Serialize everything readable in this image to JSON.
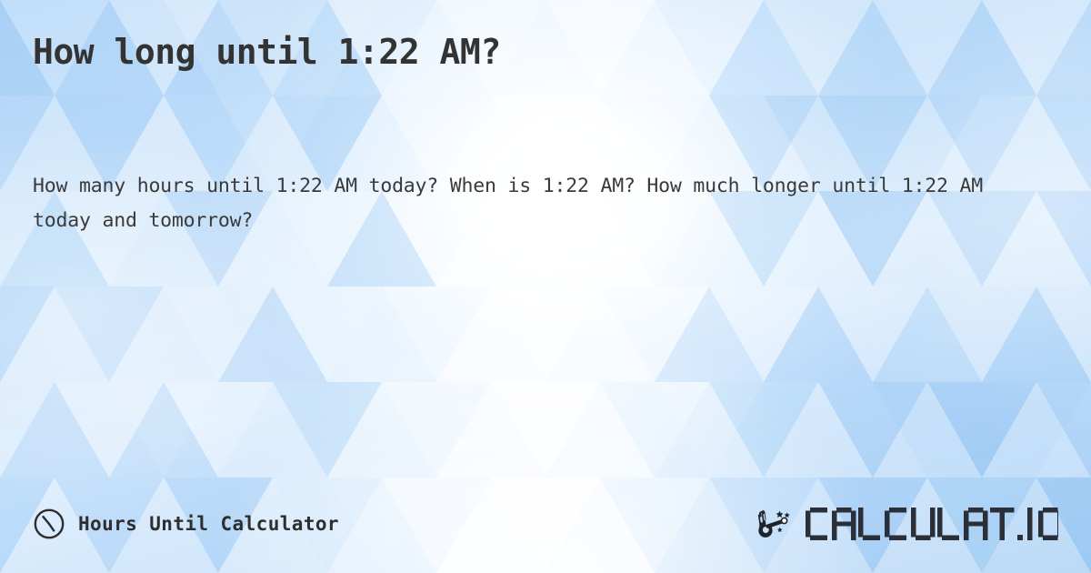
{
  "page": {
    "title": "How long until 1:22 AM?",
    "description": "How many hours until 1:22 AM today? When is 1:22 AM? How much longer until 1:22 AM today and tomorrow?"
  },
  "footer": {
    "brand_name": "Hours Until Calculator",
    "clock_icon": "clock-icon",
    "logo": {
      "text": "CALCULAT.IO",
      "wand_icon": "magic-wand-hand-icon"
    }
  },
  "colors": {
    "background_light": "#d6eafd",
    "background_mid": "#c3ddf9",
    "background_deep": "#a9d0f4",
    "title_text": "#333333",
    "body_text": "#3a3a3a",
    "footer_text": "#2e2e2e",
    "logo_text": "#2b3038"
  }
}
